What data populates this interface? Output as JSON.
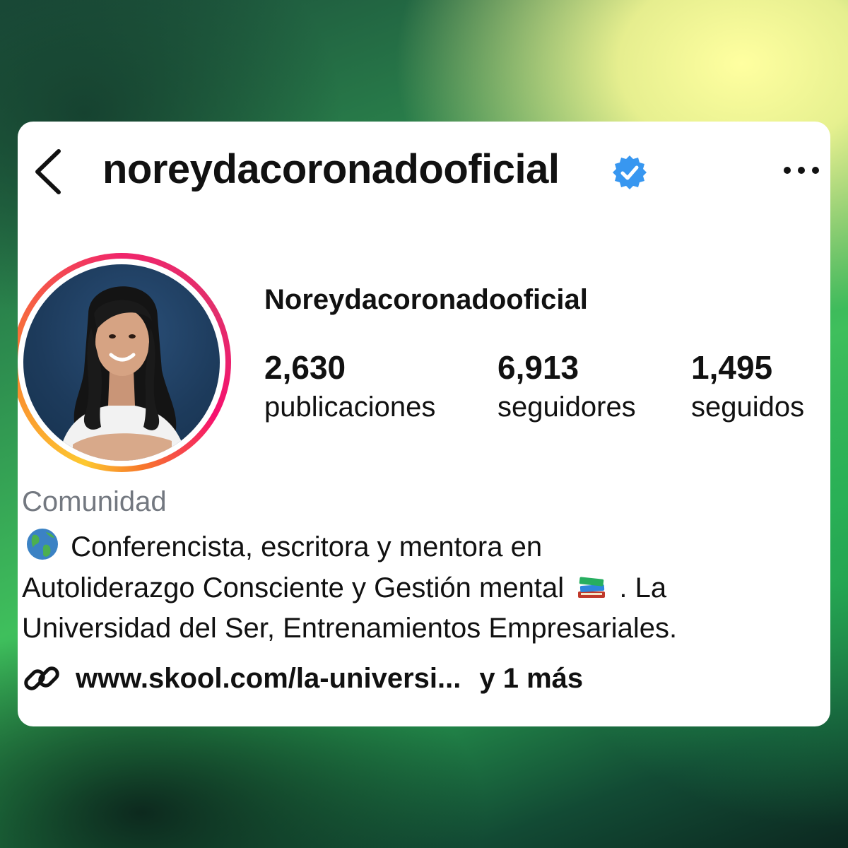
{
  "header": {
    "username": "noreydacoronadooficial",
    "verified": true,
    "back_icon": "chevron-left-icon",
    "more_icon": "ellipsis-icon"
  },
  "profile": {
    "display_name": "Noreydacoronadooficial",
    "stats": [
      {
        "value": "2,630",
        "label": "publicaciones"
      },
      {
        "value": "6,913",
        "label": "seguidores"
      },
      {
        "value": "1,495",
        "label": "seguidos"
      }
    ],
    "category": "Comunidad",
    "bio": {
      "line1": "Conferencista, escritora y mentora en",
      "line2_a": "Autoliderazgo Consciente y Gestión mental",
      "line2_b": ". La",
      "line3": "Universidad del Ser, Entrenamientos Empresariales."
    },
    "link": {
      "text": "www.skool.com/la-universi...",
      "more": "y 1 más"
    }
  },
  "colors": {
    "verified_blue": "#3897f0",
    "text_primary": "#111111",
    "text_secondary": "#737880",
    "story_ring": [
      "#fdc830",
      "#f97f2f",
      "#e1306c"
    ]
  }
}
